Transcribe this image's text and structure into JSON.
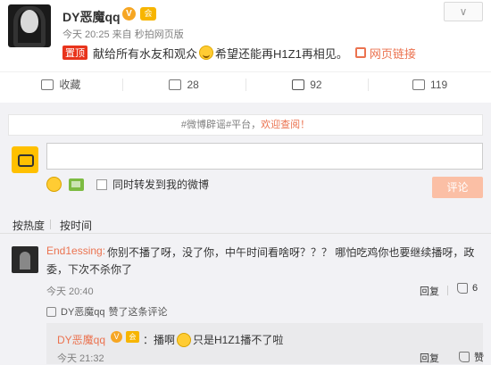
{
  "post": {
    "username": "DY恶魔qq",
    "verified_badge": "V",
    "member_badge": "会",
    "time": "今天 20:25",
    "source": "来自 秒拍网页版",
    "follow_label": "∨",
    "hot_tag": "置顶",
    "text_part1": "献给所有水友和观众",
    "text_part2": "希望还能再H1Z1再相见。",
    "web_link": "网页链接"
  },
  "actions": {
    "favorite": "收藏",
    "forward_count": "28",
    "comment_count": "92",
    "like_count": "119"
  },
  "comment_box": {
    "notice_prefix": "#微博辟谣#平台，",
    "notice_highlight": "欢迎查阅！",
    "input_value": "",
    "forward_label": "同时转发到我的微博",
    "submit_label": "评论"
  },
  "sort": {
    "by_hot": "按热度",
    "by_time": "按时间"
  },
  "comment": {
    "user": "End1essing:",
    "text": "你别不播了呀，没了你，中午时间看啥呀？？？ 哪怕吃鸡你也要继续播呀，政委，下次不杀你了",
    "time": "今天 20:40",
    "reply_label": "回复",
    "like_count": "6",
    "liked_by_user": "DY恶魔qq",
    "liked_by_text": "赞了这条评论"
  },
  "reply": {
    "user": "DY恶魔qq",
    "verified_badge": "V",
    "member_badge": "会",
    "text_part1": "：播啊",
    "text_part2": "只是H1Z1播不了啦",
    "time": "今天 21:32",
    "reply_label": "回复",
    "like_label": "赞"
  },
  "colors": {
    "accent": "#eb7350",
    "hot_tag": "#e8341c",
    "badge": "#f6a623"
  }
}
